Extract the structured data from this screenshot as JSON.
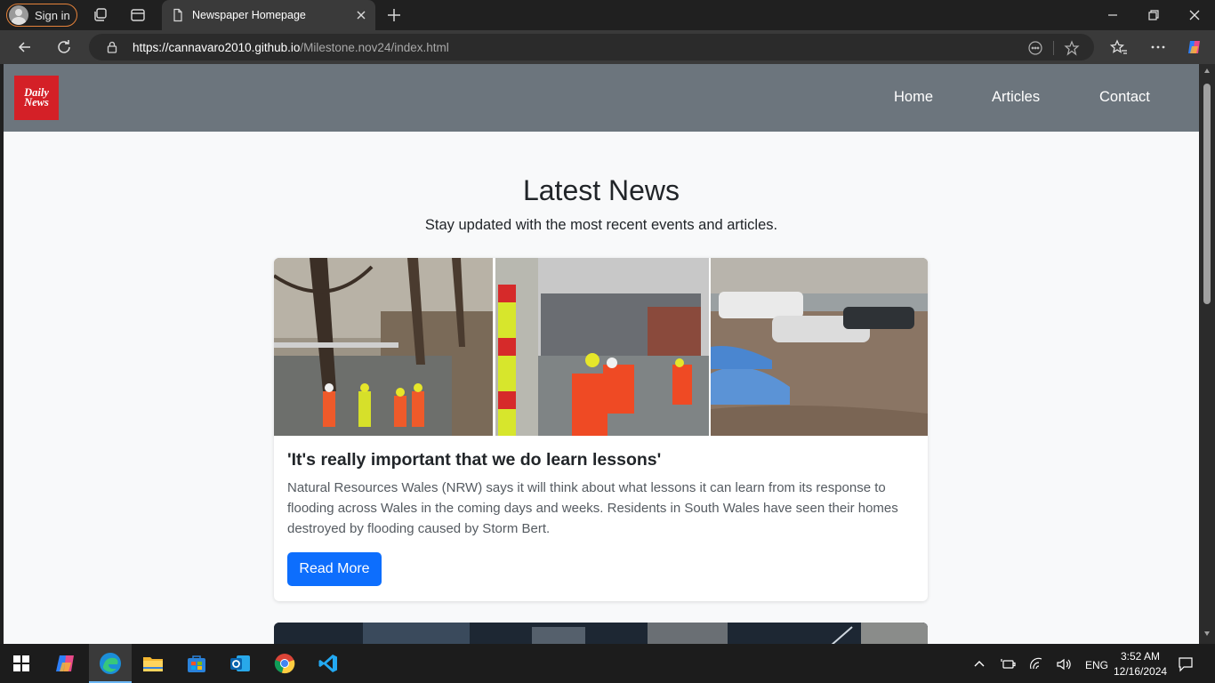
{
  "browser": {
    "signin_label": "Sign in",
    "tab_title": "Newspaper Homepage",
    "url_host": "https://cannavaro2010.github.io",
    "url_path": "/Milestone.nov24/index.html"
  },
  "site": {
    "logo_line1": "Daily",
    "logo_line2": "News",
    "nav": [
      {
        "label": "Home"
      },
      {
        "label": "Articles"
      },
      {
        "label": "Contact"
      }
    ],
    "hero_title": "Latest News",
    "hero_subtitle": "Stay updated with the most recent events and articles.",
    "articles": [
      {
        "title": "'It's really important that we do learn lessons'",
        "text": "Natural Resources Wales (NRW) says it will think about what lessons it can learn from its response to flooding across Wales in the coming days and weeks. Residents in South Wales have seen their homes destroyed by flooding caused by Storm Bert.",
        "button": "Read More"
      }
    ]
  },
  "taskbar": {
    "language": "ENG",
    "time": "3:52 AM",
    "date": "12/16/2024"
  },
  "colors": {
    "header_bg": "#6c757d",
    "logo_bg": "#d42027",
    "button_bg": "#0d6efd",
    "page_bg": "#f8f9fa"
  }
}
